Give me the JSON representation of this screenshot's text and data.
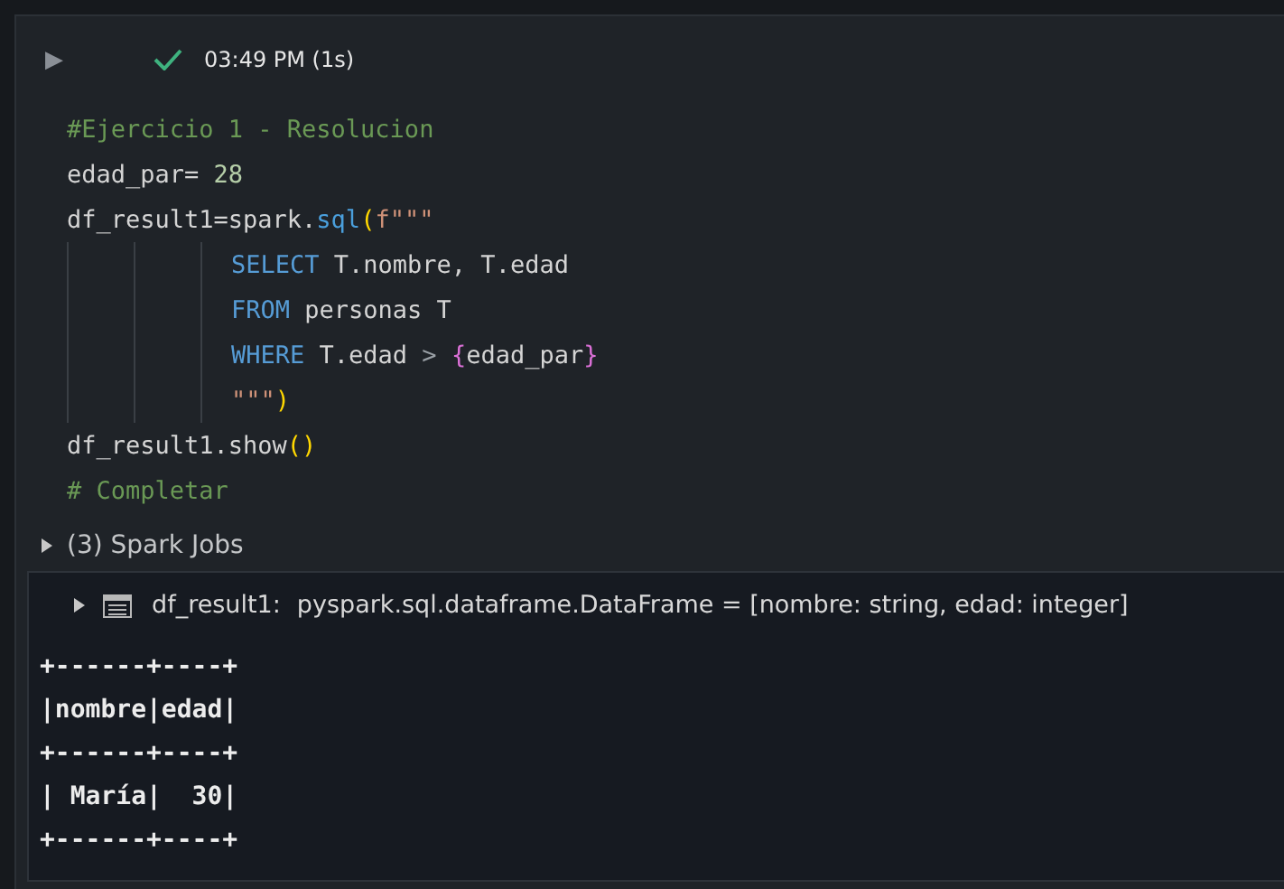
{
  "cell": {
    "run_button": "▶",
    "status": {
      "ok": true,
      "time": "03:49 PM (1s)"
    },
    "code": [
      {
        "indented": false,
        "tokens": [
          {
            "text": "#Ejercicio 1 - Resolucion",
            "kind": "comment"
          }
        ]
      },
      {
        "indented": false,
        "tokens": [
          {
            "text": "edad_par= ",
            "kind": "plain"
          },
          {
            "text": "28",
            "kind": "number"
          }
        ]
      },
      {
        "indented": false,
        "tokens": [
          {
            "text": "df_result1=spark.",
            "kind": "plain"
          },
          {
            "text": "sql",
            "kind": "function"
          },
          {
            "text": "(",
            "kind": "paren"
          },
          {
            "text": "f\"\"\"",
            "kind": "string"
          }
        ]
      },
      {
        "indented": true,
        "tokens": [
          {
            "text": "SELECT",
            "kind": "keyword"
          },
          {
            "text": " T.nombre, T.edad",
            "kind": "plain"
          }
        ]
      },
      {
        "indented": true,
        "tokens": [
          {
            "text": "FROM",
            "kind": "keyword"
          },
          {
            "text": " personas T",
            "kind": "plain"
          }
        ]
      },
      {
        "indented": true,
        "tokens": [
          {
            "text": "WHERE",
            "kind": "keyword"
          },
          {
            "text": " T.edad ",
            "kind": "plain"
          },
          {
            "text": "> ",
            "kind": "operator"
          },
          {
            "text": "{",
            "kind": "brace"
          },
          {
            "text": "edad_par",
            "kind": "plain"
          },
          {
            "text": "}",
            "kind": "brace"
          }
        ]
      },
      {
        "indented": true,
        "tokens": [
          {
            "text": "\"\"\"",
            "kind": "string"
          },
          {
            "text": ")",
            "kind": "paren"
          }
        ]
      },
      {
        "indented": false,
        "tokens": [
          {
            "text": "df_result1.show",
            "kind": "plain"
          },
          {
            "text": "()",
            "kind": "paren"
          }
        ]
      },
      {
        "indented": false,
        "tokens": [
          {
            "text": "# Completar",
            "kind": "comment"
          }
        ]
      }
    ],
    "spark_jobs": {
      "label": "(3) Spark Jobs",
      "expanded": false
    },
    "output": {
      "expanded": false,
      "name": "df_result1:",
      "schema": "pyspark.sql.dataframe.DataFrame = [nombre: string, edad: integer]",
      "lines": [
        "+------+----+",
        "|nombre|edad|",
        "+------+----+",
        "| María|  30|",
        "+------+----+"
      ]
    }
  }
}
